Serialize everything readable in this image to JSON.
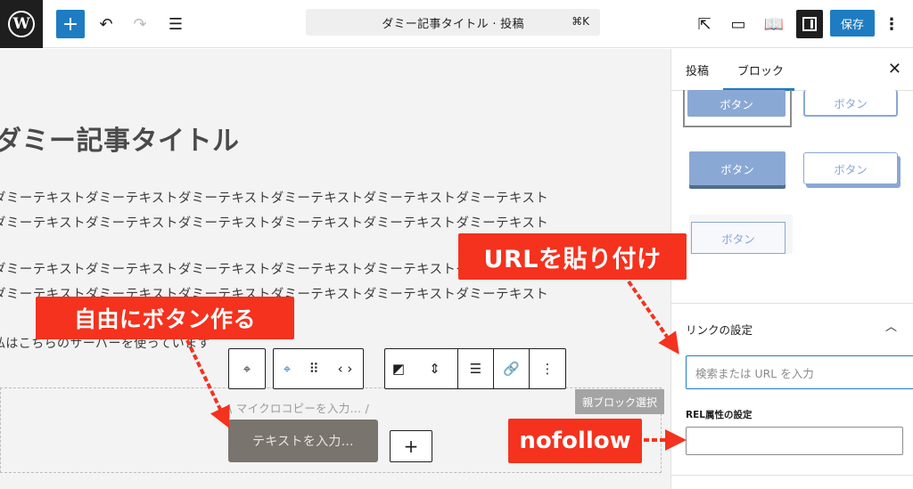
{
  "topbar": {
    "logo": "W",
    "add_label": "+",
    "undo_label": "↶",
    "redo_label": "↷",
    "listview_label": "☰",
    "document_title": "ダミー記事タイトル · 投稿",
    "shortcut": "⌘K",
    "external_label": "⇱",
    "desktop_label": "▭",
    "book_label": "📖",
    "save_label": "保存",
    "more_label": "⋮"
  },
  "editor": {
    "title": "ダミー記事タイトル",
    "para1_line1": "ダミーテキストダミーテキストダミーテキストダミーテキストダミーテキストダミーテキスト",
    "para1_line2": "ダミーテキストダミーテキストダミーテキストダミーテキストダミーテキストダミーテキスト",
    "para2_line1": "ダミーテキストダミーテキストダミーテキストダミーテキストダミーテキストダミーテキスト",
    "para2_line2": "ダミーテキストダミーテキストダミーテキストダミーテキストダミーテキストダミーテキスト",
    "para3": "私はこちらのサーバーを使っています",
    "micro_copy": "\\ マイクロコピーを入力… /",
    "button_placeholder": "テキストを入力…",
    "add_block_label": "+",
    "parent_select_label": "親ブロック選択",
    "toolbar": {
      "block_icon": "⌖",
      "button_icon": "⌖",
      "drag_icon": "⠿",
      "move_icon": "‹ ›",
      "style_icon": "◩",
      "height_icon": "⇕",
      "align_icon": "☰",
      "link_icon": "🔗",
      "more_icon": "⋮"
    }
  },
  "sidebar": {
    "tab_post": "投稿",
    "tab_block": "ブロック",
    "close_label": "✕",
    "style_labels": [
      "ボタン",
      "ボタン",
      "ボタン",
      "ボタン",
      "ボタン"
    ],
    "link_settings_title": "リンクの設定",
    "chevron_label": "︿",
    "url_placeholder": "検索または URL を入力",
    "rel_label": "REL属性の設定"
  },
  "annotations": {
    "url_callout": "URLを貼り付け",
    "free_callout": "自由にボタン作る",
    "nofollow_callout": "nofollow",
    "accent": "#f4321e"
  },
  "colors": {
    "wp_blue": "#1e7cc2",
    "button_style": "#8aa8d4",
    "button_fill": "#7a746e"
  }
}
